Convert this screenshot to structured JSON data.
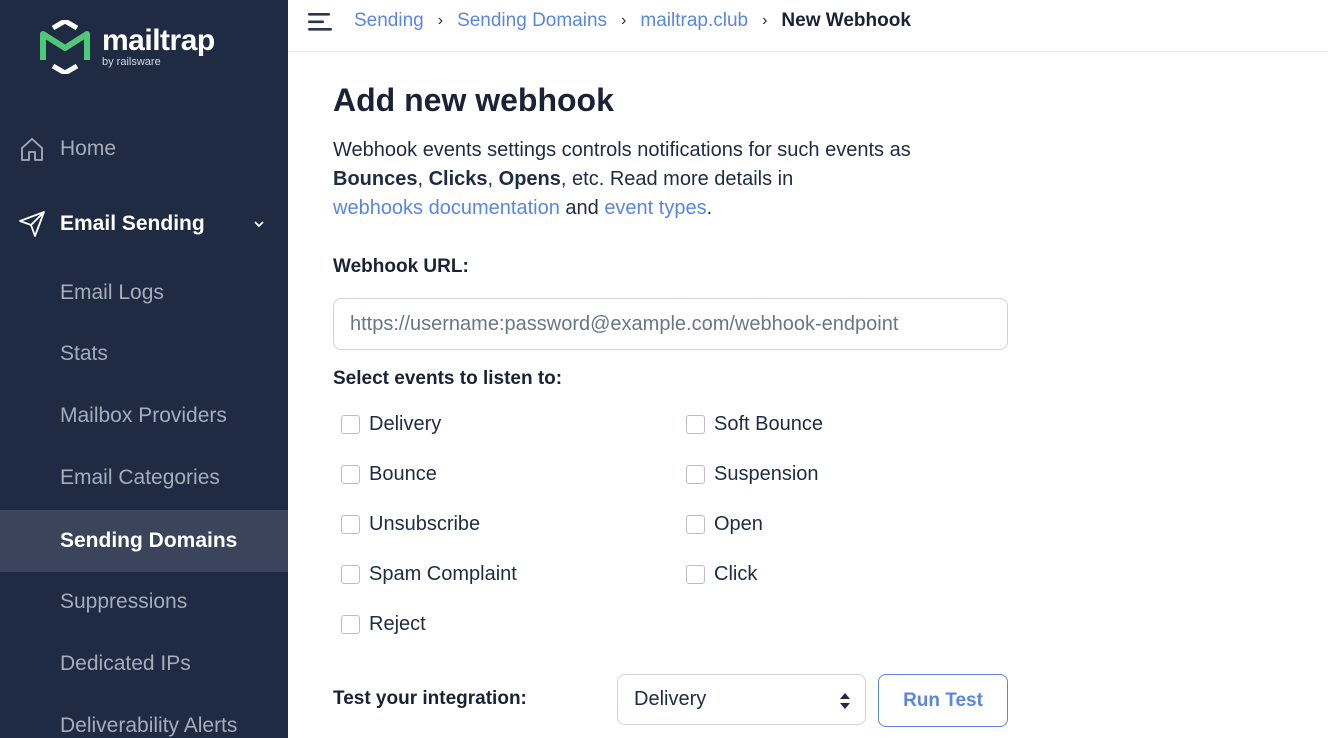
{
  "brand": {
    "name": "mailtrap",
    "subtitle": "by railsware",
    "logo_green": "#4fc977"
  },
  "sidebar": {
    "items": [
      {
        "label": "Home",
        "icon": "home-icon"
      },
      {
        "label": "Email Sending",
        "icon": "paper-plane-icon",
        "expanded": true
      },
      {
        "label": "Email Logs"
      },
      {
        "label": "Stats"
      },
      {
        "label": "Mailbox Providers"
      },
      {
        "label": "Email Categories"
      },
      {
        "label": "Sending Domains",
        "active": true
      },
      {
        "label": "Suppressions"
      },
      {
        "label": "Dedicated IPs"
      },
      {
        "label": "Deliverability Alerts"
      }
    ]
  },
  "topbar": {
    "menu_icon": "hamburger-menu-icon",
    "breadcrumb": [
      {
        "label": "Sending"
      },
      {
        "label": "Sending Domains"
      },
      {
        "label": "mailtrap.club"
      },
      {
        "label": "New Webhook"
      }
    ],
    "separator": "›"
  },
  "main": {
    "title": "Add new webhook",
    "intro": {
      "line1": "Webhook events settings controls notifications for such events as",
      "bold1": "Bounces",
      "bold2": "Clicks",
      "bold3": "Opens",
      "comma": ", ",
      "rest": ", etc. Read more details in",
      "link1": "webhooks documentation",
      "and": " and ",
      "link2": "event types",
      "period": "."
    },
    "url_label": "Webhook URL:",
    "url_placeholder": "https://username:password@example.com/webhook-endpoint",
    "url_value": "",
    "events_label": "Select events to listen to:",
    "events": [
      {
        "label": "Delivery",
        "checked": false
      },
      {
        "label": "Soft Bounce",
        "checked": false
      },
      {
        "label": "Bounce",
        "checked": false
      },
      {
        "label": "Suspension",
        "checked": false
      },
      {
        "label": "Unsubscribe",
        "checked": false
      },
      {
        "label": "Open",
        "checked": false
      },
      {
        "label": "Spam Complaint",
        "checked": false
      },
      {
        "label": "Click",
        "checked": false
      },
      {
        "label": "Reject",
        "checked": false
      }
    ],
    "test_label": "Test your integration:",
    "test_select_value": "Delivery",
    "run_test_label": "Run Test"
  },
  "colors": {
    "sidebar_bg": "#1f2b43",
    "sidebar_active": "#3a455c",
    "link": "#5a86e0",
    "text": "#1a2236"
  }
}
